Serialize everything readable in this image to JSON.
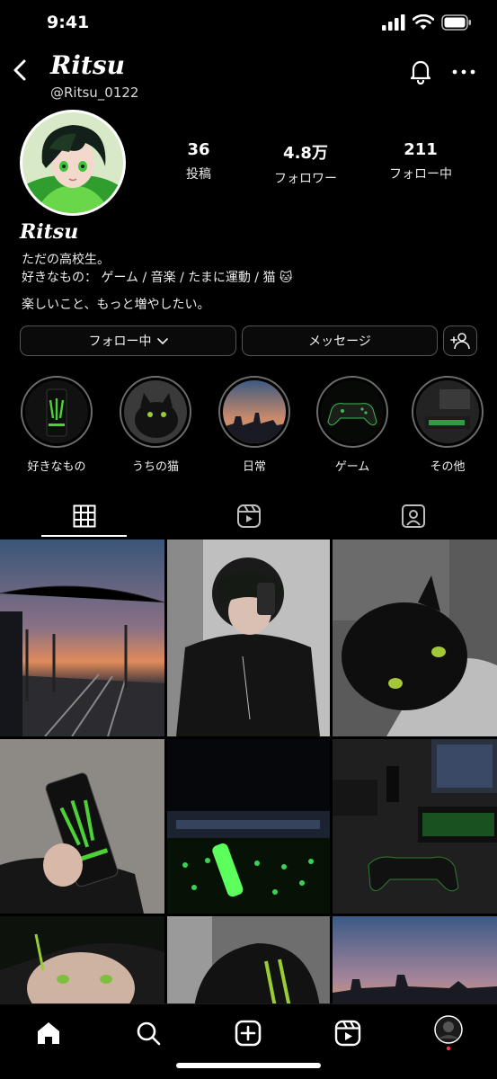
{
  "status_bar": {
    "time": "9:41"
  },
  "profile": {
    "display_name": "Ritsu",
    "username": "@Ritsu_0122",
    "stats": [
      {
        "value": "36",
        "label": "投稿"
      },
      {
        "value": "4.8万",
        "label": "フォロワー"
      },
      {
        "value": "211",
        "label": "フォロー中"
      }
    ],
    "bio_name": "Ritsu",
    "bio_lines": [
      "ただの高校生。",
      "好きなもの： ゲーム / 音楽 / たまに運動 / 猫 🐱",
      "楽しいこと、もっと増やしたい。"
    ]
  },
  "actions": {
    "following_label": "フォロー中",
    "message_label": "メッセージ"
  },
  "highlights": [
    {
      "label": "好きなもの",
      "icon": "energy-can-photo"
    },
    {
      "label": "うちの猫",
      "icon": "cat-photo"
    },
    {
      "label": "日常",
      "icon": "sunset-photo"
    },
    {
      "label": "ゲーム",
      "icon": "controller-photo"
    },
    {
      "label": "その他",
      "icon": "desk-photo"
    }
  ],
  "tabs": [
    "grid-icon",
    "reels-icon",
    "tagged-icon"
  ],
  "posts": [
    "sunset-station-photo",
    "mirror-selfie-photo",
    "black-cat-photo",
    "energy-drink-photo",
    "concert-lights-photo",
    "gaming-setup-photo",
    "face-closeup-photo",
    "backpack-photo",
    "evening-sky-photo"
  ],
  "bottom_nav": [
    "home-icon",
    "search-icon",
    "create-icon",
    "reels-icon",
    "profile-avatar"
  ],
  "colors": {
    "accent_green": "#39d353",
    "background": "#000000",
    "notification_dot": "#ff3040"
  }
}
